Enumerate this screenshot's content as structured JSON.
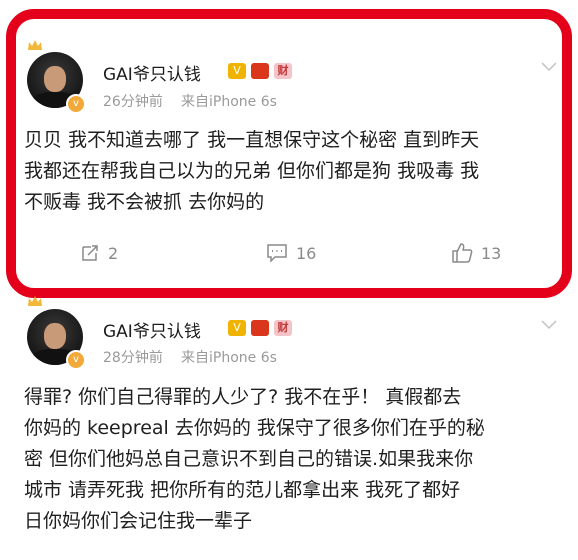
{
  "posts": [
    {
      "user": "GAI爷只认钱",
      "badges": {
        "vip": "V",
        "red": "",
        "cai": "财"
      },
      "time": "26分钟前",
      "source": "来自iPhone 6s",
      "lines": [
        "贝贝 我不知道去哪了 我一直想保守这个秘密 直到昨天",
        "我都还在帮我自己以为的兄弟 但你们都是狗 我吸毒 我",
        "不贩毒 我不会被抓 去你妈的"
      ],
      "reposts": "2",
      "comments": "16",
      "likes": "13"
    },
    {
      "user": "GAI爷只认钱",
      "badges": {
        "vip": "V",
        "red": "",
        "cai": "财"
      },
      "time": "28分钟前",
      "source": "来自iPhone 6s",
      "lines": [
        "得罪? 你们自己得罪的人少了? 我不在乎！ 真假都去",
        "你妈的 keepreal 去你妈的 我保守了很多你们在乎的秘",
        "密 但你们他妈总自己意识不到自己的错误.如果我来你",
        "城市 请弄死我 把你所有的范儿都拿出来 我死了都好",
        "日你妈你们会记住我一辈子"
      ]
    }
  ],
  "colors": {
    "highlight": "#e4001b",
    "meta": "#9a9a9a"
  }
}
